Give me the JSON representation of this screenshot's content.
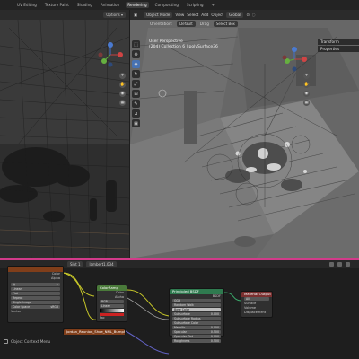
{
  "workspace_tabs": [
    "",
    "UV Editing",
    "Texture Paint",
    "Shading",
    "Animation",
    "Rendering",
    "Compositing",
    "Scripting",
    "+"
  ],
  "active_tab_index": 5,
  "left_viewport": {
    "options_label": "Options ▾"
  },
  "viewport_header": {
    "mode": "Object Mode",
    "menus": [
      "View",
      "Select",
      "Add",
      "Object"
    ],
    "transform_orientation": "Global"
  },
  "viewport_subheader": {
    "orientation_label": "Orientation:",
    "orientation_value": "Default",
    "drag_label": "Drag",
    "select_label": "Select Box"
  },
  "viewport_info": {
    "line1": "User Perspective",
    "line2": "(204) Collection 6 | polySurface36"
  },
  "n_panel": [
    "Transform",
    "Properties"
  ],
  "node_editor": {
    "slot": "Slot 1",
    "material": "lambert1.034",
    "status_bar": "Object Context Menu"
  },
  "nodes": {
    "image_texture": {
      "title": "",
      "outputs": [
        "Color",
        "Alpha"
      ],
      "fields": [
        "Linear",
        "Flat",
        "Repeat",
        "Single Image",
        "Color Space"
      ],
      "color_space_value": "sRGB",
      "vector_label": "Vector"
    },
    "color_ramp": {
      "title": "ColorRamp",
      "rows": [
        "Color",
        "Alpha"
      ],
      "fields": [
        "RGB",
        "Linear"
      ],
      "inputs": [
        "Fac"
      ]
    },
    "principled": {
      "title": "Principled BSDF",
      "output": "BSDF",
      "fields": [
        "GGX",
        "Random Walk"
      ],
      "inputs": [
        "Base Color",
        "Subsurface",
        "Subsurface Radius",
        "Subsurface Color",
        "Metallic",
        "Specular",
        "Specular Tint",
        "Roughness"
      ],
      "values": [
        "",
        "0.000",
        "",
        "",
        "0.000",
        "0.500",
        "0.000",
        "0.500"
      ]
    },
    "material_output": {
      "title": "Material Output",
      "target": "All",
      "inputs": [
        "Surface",
        "Volume",
        "Displacement"
      ]
    },
    "bottom_node": {
      "title": "Jordan_Reunion_Shoe_NML_BumpMap"
    }
  },
  "colors": {
    "accent_blue": "#4772b3",
    "divider": "#d23a8a",
    "texture_header": "#803e1a",
    "converter_header": "#4a7a3a",
    "shader_header": "#2f7a4f",
    "output_header": "#7a2f2f",
    "link_yellow": "#c7c729",
    "link_purple": "#6363c7"
  }
}
